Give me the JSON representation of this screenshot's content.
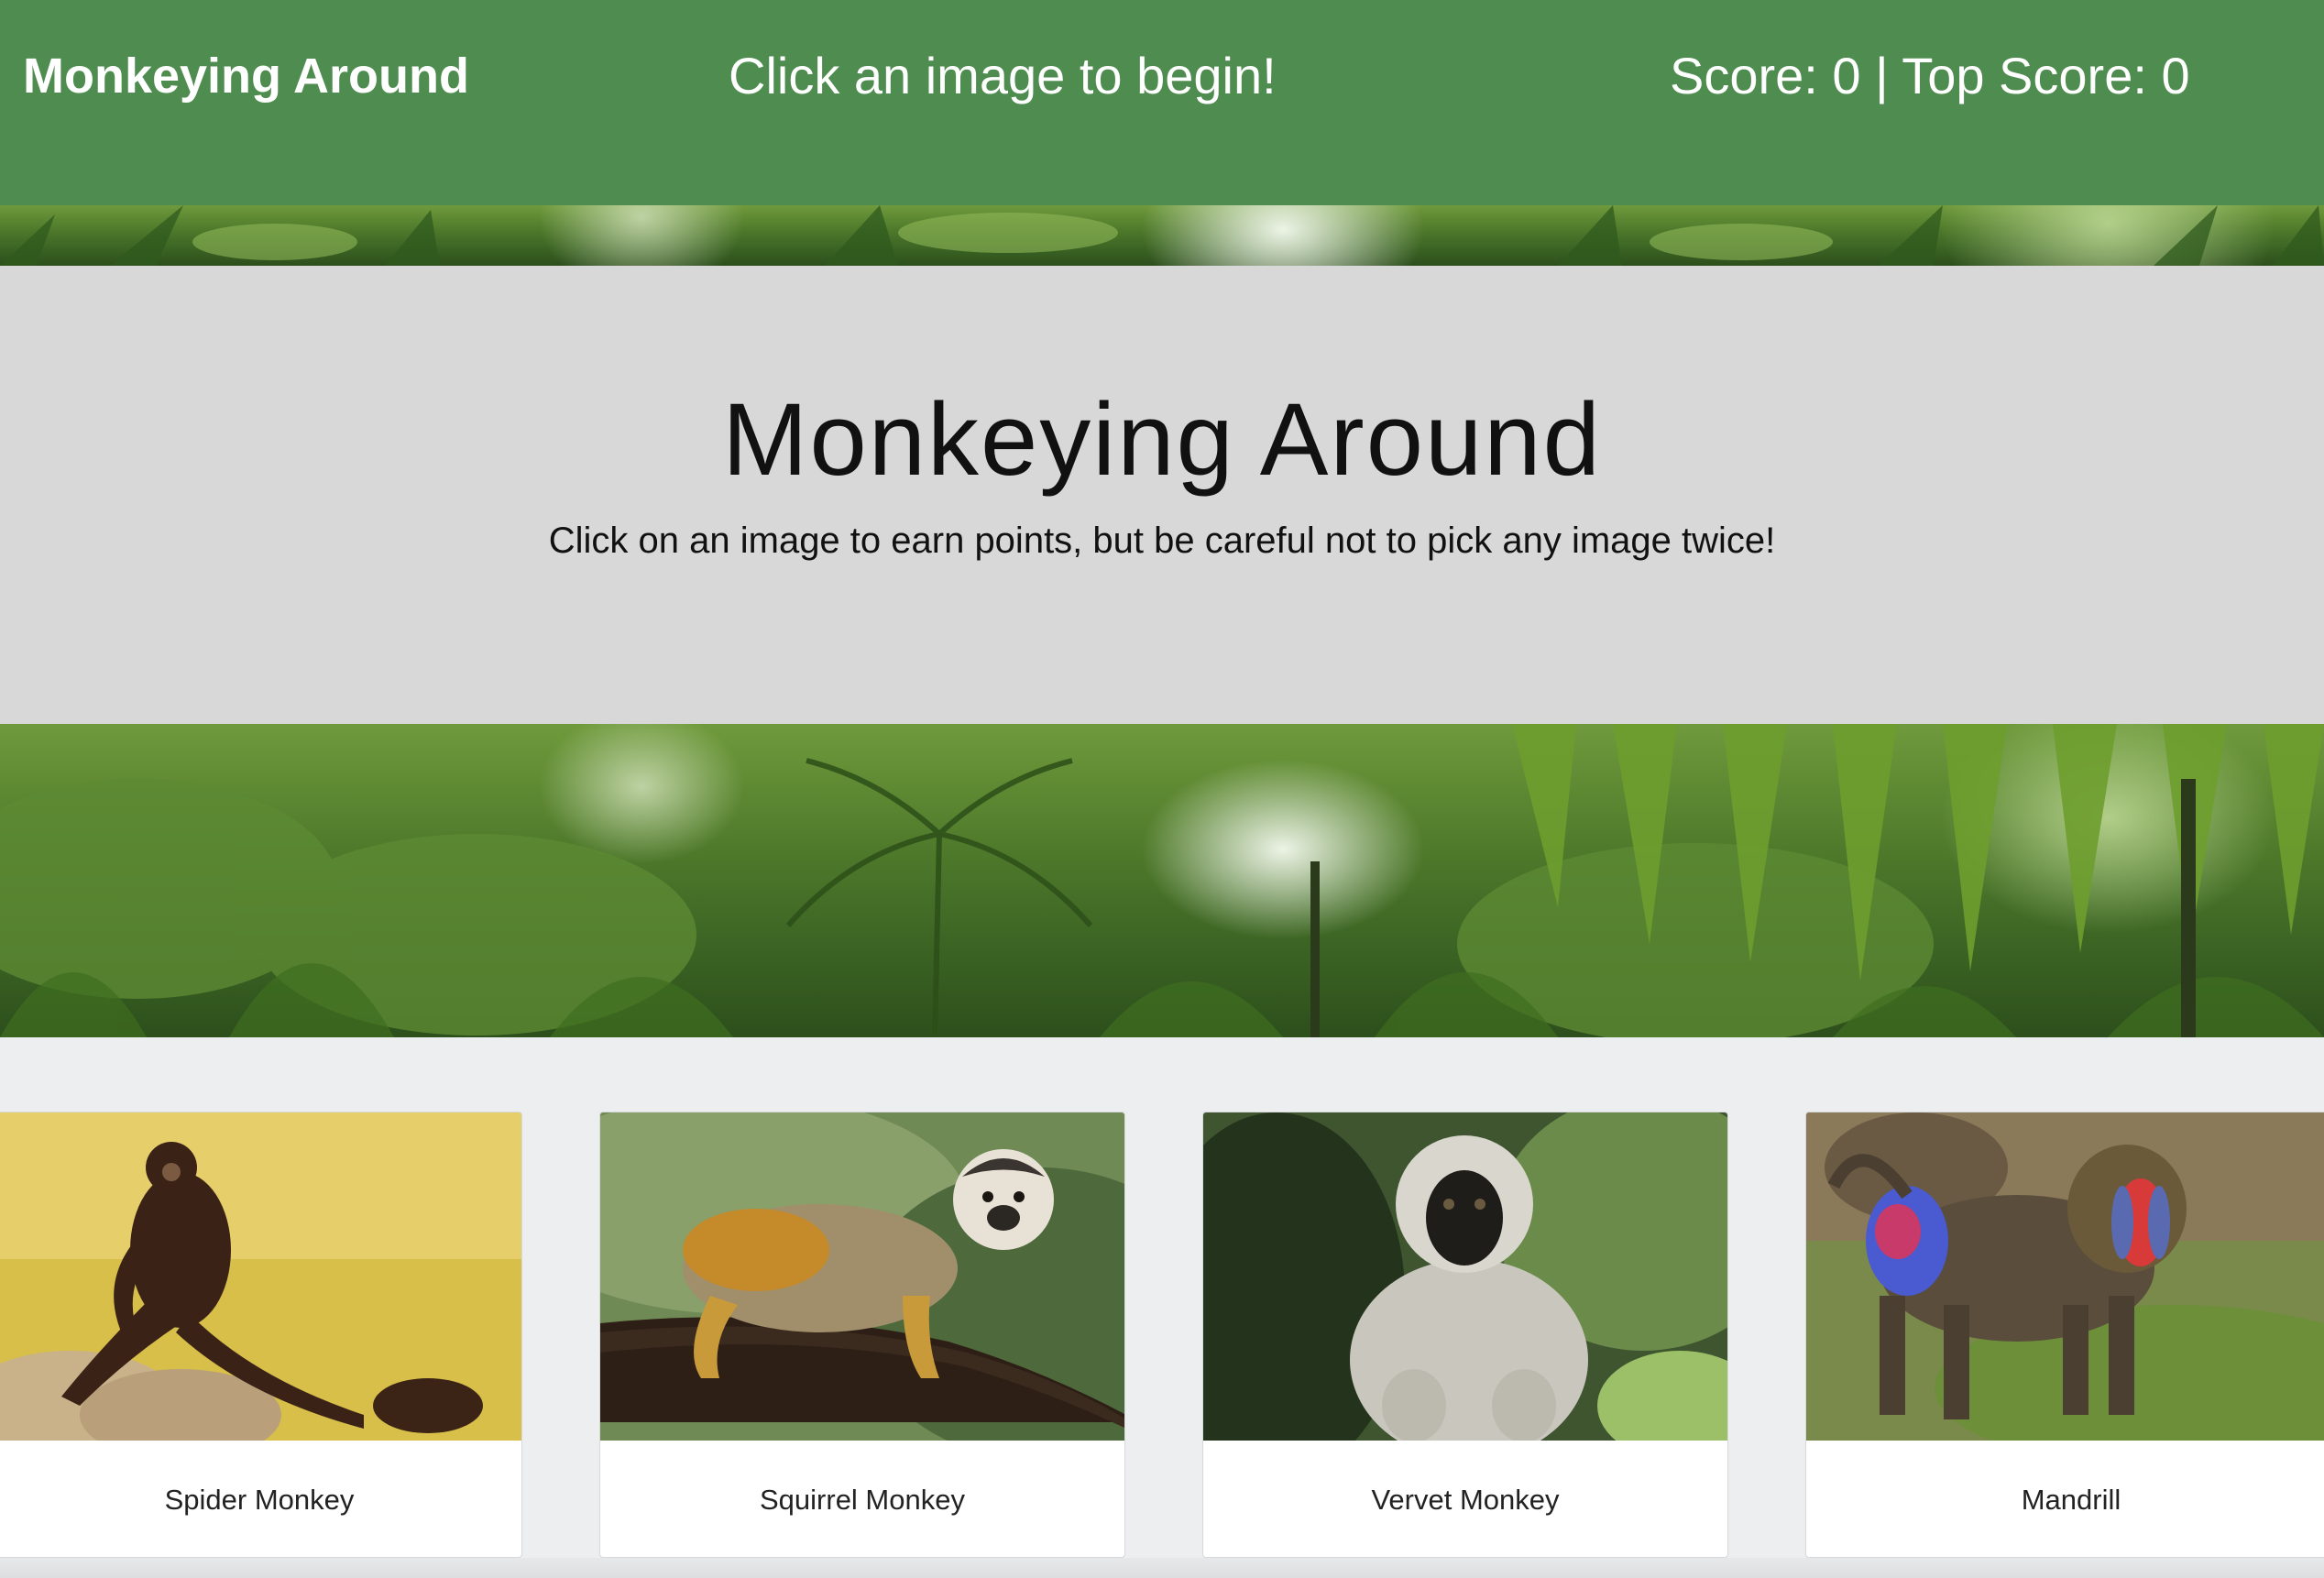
{
  "navbar": {
    "brand": "Monkeying Around",
    "message": "Click an image to begin!",
    "score": "Score: 0 | Top Score: 0"
  },
  "jumbotron": {
    "title": "Monkeying Around",
    "subtitle": "Click on an image to earn points, but be careful not to pick any image twice!"
  },
  "cards": [
    {
      "label": "Spider Monkey"
    },
    {
      "label": "Squirrel Monkey"
    },
    {
      "label": "Vervet Monkey"
    },
    {
      "label": "Mandrill"
    }
  ],
  "colors": {
    "navbar": "#4e8c4f",
    "jumbotron": "#d8d8d8",
    "page": "#eceeef"
  }
}
